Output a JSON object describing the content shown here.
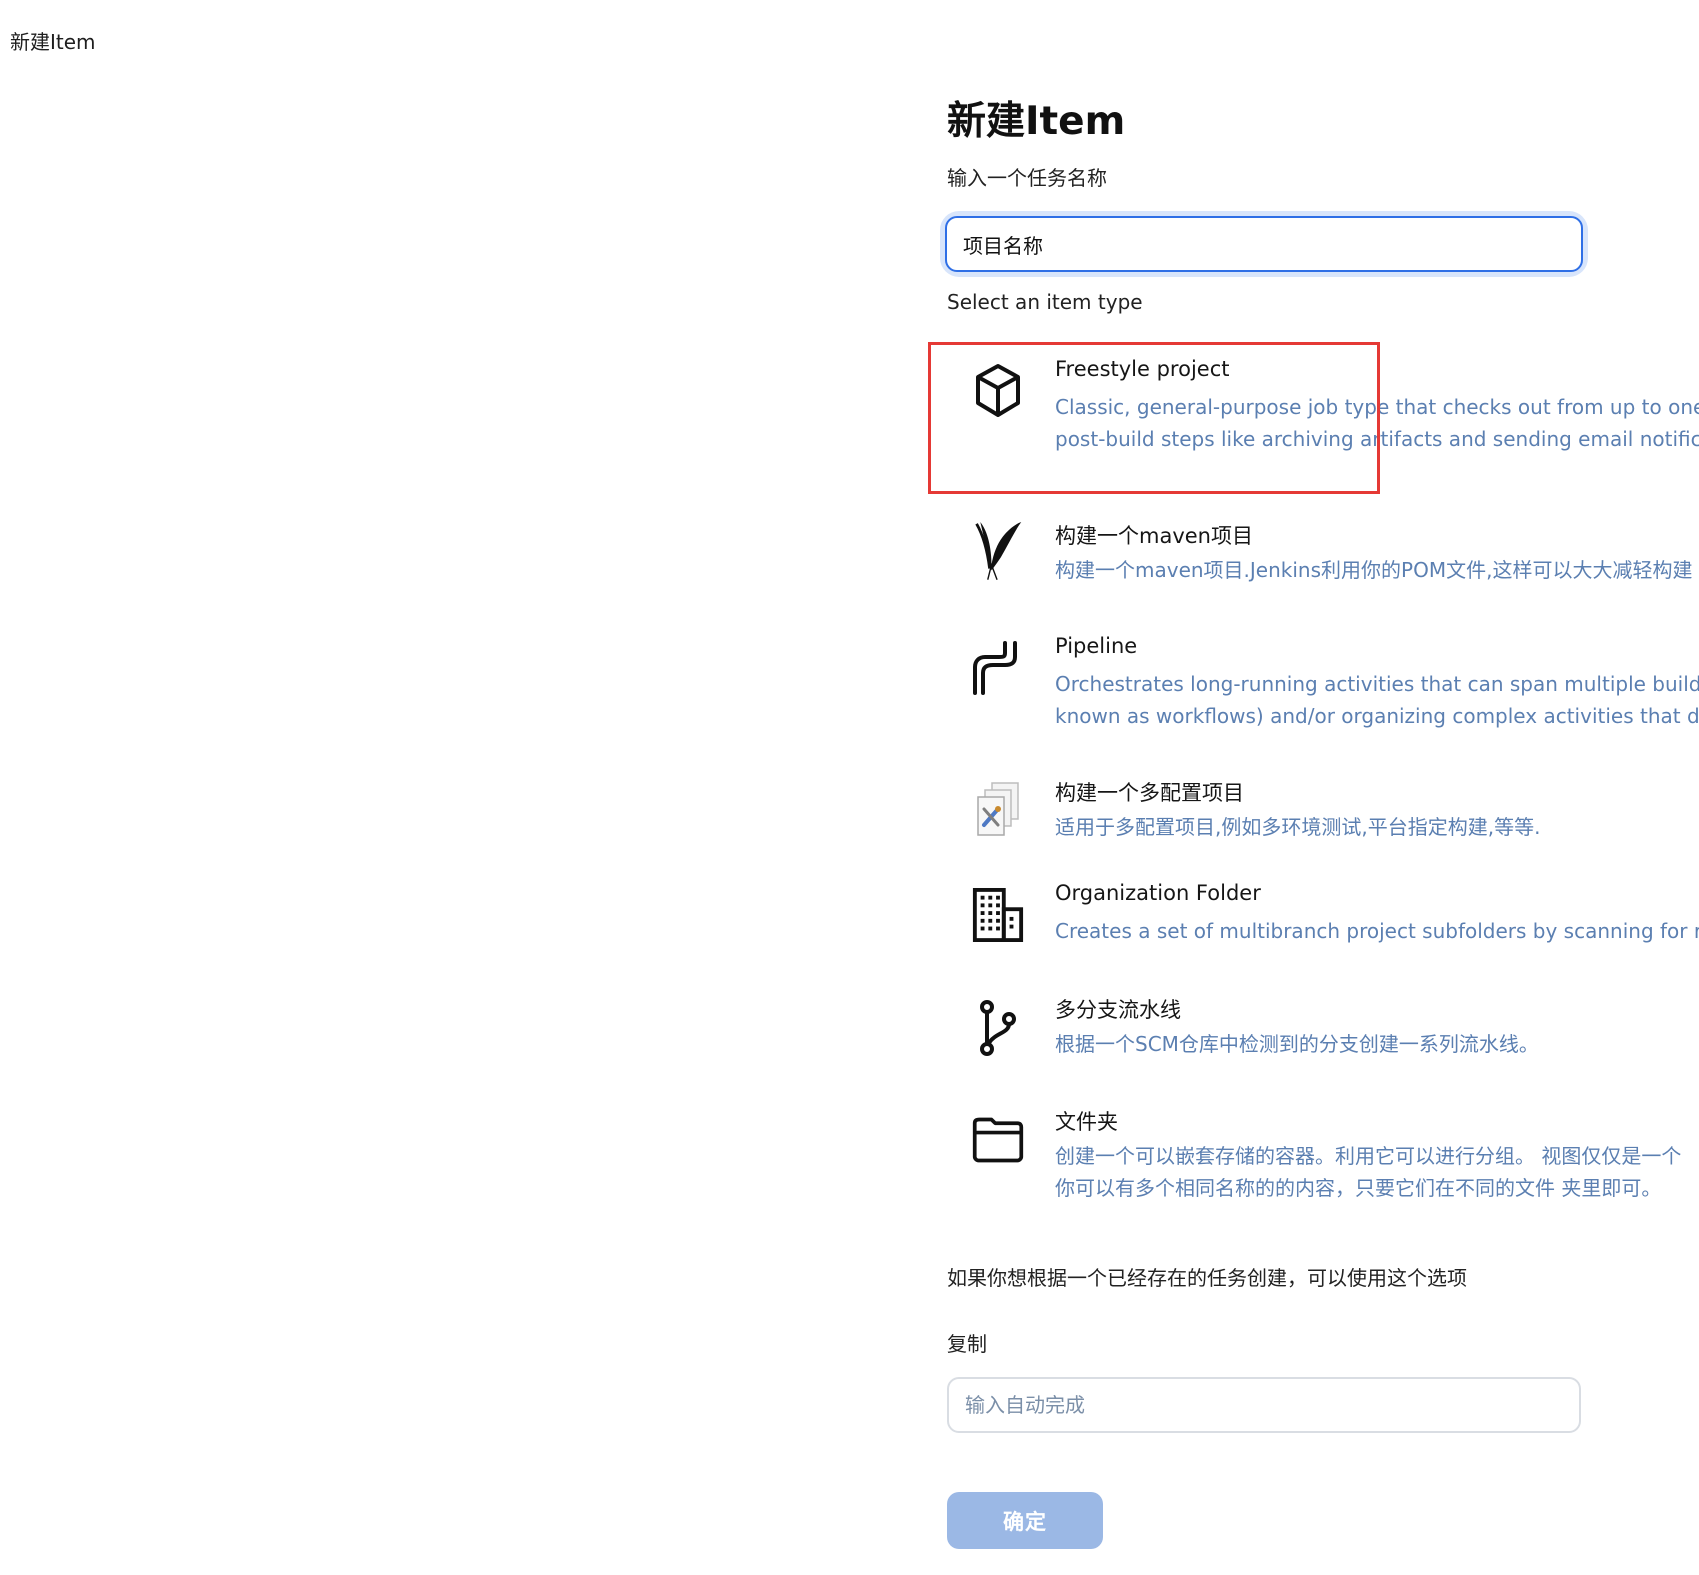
{
  "window": {
    "title": "新建Item"
  },
  "main": {
    "heading": "新建Item"
  },
  "form": {
    "name_label": "输入一个任务名称",
    "name_value": "项目名称",
    "type_label": "Select an item type",
    "copy_text": "如果你想根据一个已经存在的任务创建，可以使用这个选项",
    "copy_label": "复制",
    "copy_placeholder": "输入自动完成",
    "confirm_label": "确定"
  },
  "item_types": [
    {
      "title": "Freestyle project",
      "desc_line1": "Classic, general-purpose job type that checks out from up to one",
      "desc_line2": "post-build steps like archiving artifacts and sending email notific",
      "icon": "cube-icon"
    },
    {
      "title": "构建一个maven项目",
      "desc_line1": "构建一个maven项目.Jenkins利用你的POM文件,这样可以大大减轻构建",
      "icon": "feather-icon"
    },
    {
      "title": "Pipeline",
      "desc_line1": "Orchestrates long-running activities that can span multiple build",
      "desc_line2": "known as workflows) and/or organizing complex activities that d",
      "icon": "pipeline-icon"
    },
    {
      "title": "构建一个多配置项目",
      "desc_line1": "适用于多配置项目,例如多环境测试,平台指定构建,等等.",
      "icon": "multi-config-icon"
    },
    {
      "title": "Organization Folder",
      "desc_line1": "Creates a set of multibranch project subfolders by scanning for r",
      "icon": "building-icon"
    },
    {
      "title": "多分支流水线",
      "desc_line1": "根据一个SCM仓库中检测到的分支创建一系列流水线。",
      "icon": "branch-icon"
    },
    {
      "title": "文件夹",
      "desc_line1": "创建一个可以嵌套存储的容器。利用它可以进行分组。 视图仅仅是一个",
      "desc_line2": "你可以有多个相同名称的的内容，只要它们在不同的文件 夹里即可。",
      "icon": "folder-icon"
    }
  ],
  "colors": {
    "accent_blue": "#2f6fe6",
    "description_blue": "#5b7fb1",
    "highlight_red": "#e53935",
    "button_disabled": "#9bb8e5"
  }
}
